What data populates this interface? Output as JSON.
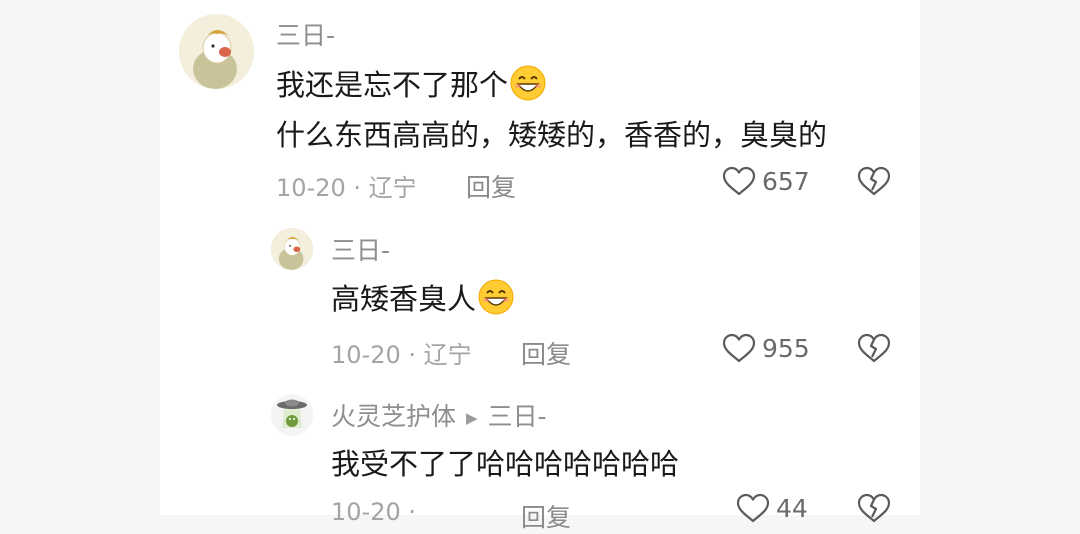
{
  "comments": [
    {
      "username": "三日-",
      "lines": [
        "我还是忘不了那个",
        "什么东西高高的，矮矮的，香香的，臭臭的"
      ],
      "emoji": "grinning-face-emoji",
      "date": "10-20",
      "location": "辽宁",
      "reply_label": "回复",
      "likes": "657"
    },
    {
      "username": "三日-",
      "lines": [
        "高矮香臭人"
      ],
      "emoji": "grinning-face-emoji",
      "date": "10-20",
      "location": "辽宁",
      "reply_label": "回复",
      "likes": "955"
    },
    {
      "username": "火灵芝护体",
      "reply_to": "三日-",
      "lines": [
        "我受不了了哈哈哈哈哈哈哈"
      ],
      "date": "10-20",
      "reply_label": "回复",
      "likes": "44"
    }
  ],
  "separator": "·",
  "colors": {
    "text": "#1a1a1a",
    "meta": "#a4a4a4",
    "username": "#8e8e8e"
  }
}
